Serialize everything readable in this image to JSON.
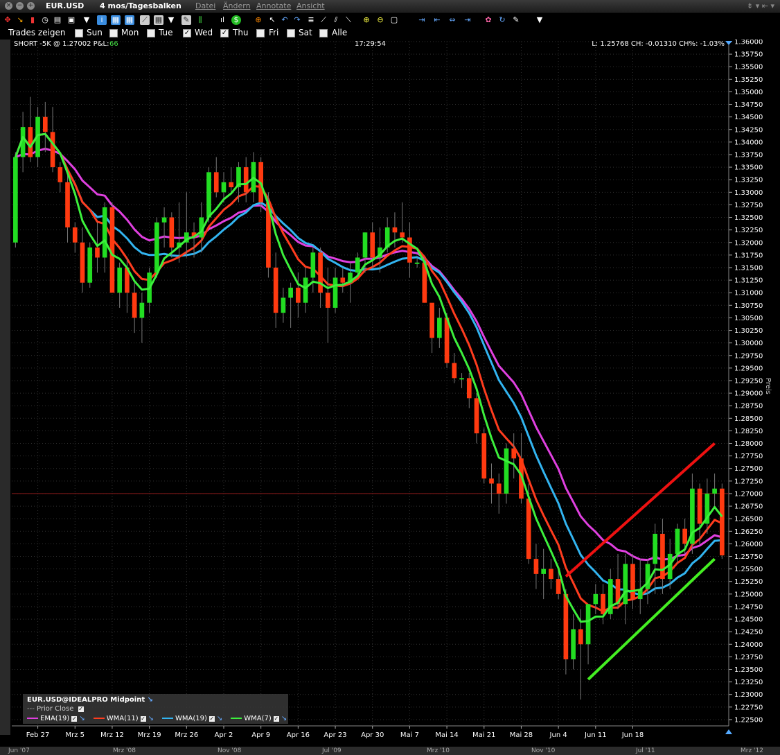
{
  "window": {
    "symbol": "EUR.USD",
    "timeframe": "4 mos/Tagesbalken",
    "menu": [
      "Datei",
      "Ändern",
      "Annotate",
      "Ansicht"
    ]
  },
  "trades_bar": {
    "label": "Trades zeigen",
    "days": [
      {
        "label": "Sun",
        "checked": false
      },
      {
        "label": "Mon",
        "checked": false
      },
      {
        "label": "Tue",
        "checked": false
      },
      {
        "label": "Wed",
        "checked": true
      },
      {
        "label": "Thu",
        "checked": true
      },
      {
        "label": "Fri",
        "checked": false
      },
      {
        "label": "Sat",
        "checked": false
      },
      {
        "label": "Alle",
        "checked": false
      }
    ]
  },
  "info": {
    "position": "SHORT -5K @ 1.27002 P&L:",
    "pnl": "66",
    "time": "17:29:54",
    "last": "L: 1.25768 CH: -0.01310 CH%: -1.03%"
  },
  "legend": {
    "title": "EUR.USD@IDEALPRO Midpoint",
    "prior_close": "Prior Close",
    "items": [
      {
        "label": "EMA(19)",
        "color": "#e040e0"
      },
      {
        "label": "WMA(11)",
        "color": "#ff3c1e"
      },
      {
        "label": "WMA(19)",
        "color": "#32b4f0"
      },
      {
        "label": "WMA(7)",
        "color": "#3cf03c"
      }
    ]
  },
  "navigator_labels": [
    "Jun '07",
    "Mrz '08",
    "Nov '08",
    "Jul '09",
    "Mrz '10",
    "Nov '10",
    "Jul '11",
    "Mrz '12"
  ],
  "colors": {
    "up": "#22dd22",
    "down": "#ff3a10",
    "background": "#000000",
    "grid": "#333333"
  },
  "chart_data": {
    "type": "candlestick",
    "ylabel": "Preis",
    "ylim": [
      1.22375,
      1.36
    ],
    "yticks": [
      "1.36000",
      "1.35750",
      "1.35500",
      "1.35250",
      "1.35000",
      "1.34750",
      "1.34500",
      "1.34250",
      "1.34000",
      "1.33750",
      "1.33500",
      "1.33250",
      "1.33000",
      "1.32750",
      "1.32500",
      "1.32250",
      "1.32000",
      "1.31750",
      "1.31500",
      "1.31250",
      "1.31000",
      "1.30750",
      "1.30500",
      "1.30250",
      "1.30000",
      "1.29750",
      "1.29500",
      "1.29250",
      "1.29000",
      "1.28750",
      "1.28500",
      "1.28250",
      "1.28000",
      "1.27750",
      "1.27500",
      "1.27250",
      "1.27000",
      "1.26750",
      "1.26500",
      "1.26250",
      "1.26000",
      "1.25750",
      "1.25500",
      "1.25250",
      "1.25000",
      "1.24750",
      "1.24500",
      "1.24250",
      "1.24000",
      "1.23750",
      "1.23500",
      "1.23250",
      "1.23000",
      "1.22750",
      "1.22500"
    ],
    "xticks": [
      {
        "label": "Feb 27",
        "bar": 3
      },
      {
        "label": "Mrz 5",
        "bar": 8
      },
      {
        "label": "Mrz 12",
        "bar": 13
      },
      {
        "label": "Mrz 19",
        "bar": 18
      },
      {
        "label": "Mrz 26",
        "bar": 23
      },
      {
        "label": "Apr 2",
        "bar": 28
      },
      {
        "label": "Apr 9",
        "bar": 33
      },
      {
        "label": "Apr 16",
        "bar": 38
      },
      {
        "label": "Apr 23",
        "bar": 43
      },
      {
        "label": "Apr 30",
        "bar": 48
      },
      {
        "label": "Mai 7",
        "bar": 53
      },
      {
        "label": "Mai 14",
        "bar": 58
      },
      {
        "label": "Mai 21",
        "bar": 63
      },
      {
        "label": "Mai 28",
        "bar": 68
      },
      {
        "label": "Jun 4",
        "bar": 73
      },
      {
        "label": "Jun 11",
        "bar": 78
      },
      {
        "label": "Jun 18",
        "bar": 83
      }
    ],
    "candles": [
      [
        1.32,
        1.338,
        1.319,
        1.337
      ],
      [
        1.337,
        1.346,
        1.334,
        1.343
      ],
      [
        1.343,
        1.349,
        1.336,
        1.337
      ],
      [
        1.337,
        1.347,
        1.335,
        1.345
      ],
      [
        1.345,
        1.348,
        1.338,
        1.342
      ],
      [
        1.342,
        1.347,
        1.334,
        1.335
      ],
      [
        1.335,
        1.336,
        1.33,
        1.332
      ],
      [
        1.332,
        1.334,
        1.32,
        1.323
      ],
      [
        1.323,
        1.324,
        1.318,
        1.32
      ],
      [
        1.32,
        1.323,
        1.31,
        1.312
      ],
      [
        1.312,
        1.32,
        1.311,
        1.319
      ],
      [
        1.319,
        1.324,
        1.314,
        1.317
      ],
      [
        1.317,
        1.328,
        1.314,
        1.327
      ],
      [
        1.327,
        1.328,
        1.312,
        1.31
      ],
      [
        1.31,
        1.316,
        1.307,
        1.315
      ],
      [
        1.315,
        1.317,
        1.306,
        1.31
      ],
      [
        1.31,
        1.312,
        1.302,
        1.305
      ],
      [
        1.305,
        1.31,
        1.3,
        1.308
      ],
      [
        1.308,
        1.315,
        1.306,
        1.314
      ],
      [
        1.314,
        1.325,
        1.313,
        1.324
      ],
      [
        1.324,
        1.327,
        1.319,
        1.325
      ],
      [
        1.325,
        1.326,
        1.317,
        1.319
      ],
      [
        1.319,
        1.328,
        1.316,
        1.32
      ],
      [
        1.32,
        1.33,
        1.317,
        1.322
      ],
      [
        1.322,
        1.324,
        1.317,
        1.321
      ],
      [
        1.321,
        1.328,
        1.318,
        1.325
      ],
      [
        1.325,
        1.335,
        1.324,
        1.334
      ],
      [
        1.334,
        1.337,
        1.329,
        1.33
      ],
      [
        1.33,
        1.334,
        1.328,
        1.332
      ],
      [
        1.332,
        1.335,
        1.33,
        1.331
      ],
      [
        1.331,
        1.336,
        1.328,
        1.335
      ],
      [
        1.335,
        1.337,
        1.328,
        1.33
      ],
      [
        1.33,
        1.338,
        1.328,
        1.336
      ],
      [
        1.336,
        1.337,
        1.326,
        1.328
      ],
      [
        1.328,
        1.33,
        1.313,
        1.315
      ],
      [
        1.315,
        1.318,
        1.303,
        1.306
      ],
      [
        1.306,
        1.311,
        1.304,
        1.309
      ],
      [
        1.309,
        1.312,
        1.303,
        1.311
      ],
      [
        1.311,
        1.314,
        1.305,
        1.308
      ],
      [
        1.308,
        1.315,
        1.306,
        1.313
      ],
      [
        1.313,
        1.319,
        1.31,
        1.318
      ],
      [
        1.318,
        1.319,
        1.307,
        1.31
      ],
      [
        1.31,
        1.315,
        1.3,
        1.307
      ],
      [
        1.307,
        1.315,
        1.306,
        1.313
      ],
      [
        1.313,
        1.315,
        1.31,
        1.312
      ],
      [
        1.312,
        1.316,
        1.308,
        1.314
      ],
      [
        1.314,
        1.318,
        1.313,
        1.317
      ],
      [
        1.317,
        1.322,
        1.314,
        1.322
      ],
      [
        1.322,
        1.324,
        1.315,
        1.317
      ],
      [
        1.317,
        1.323,
        1.314,
        1.319
      ],
      [
        1.319,
        1.325,
        1.318,
        1.323
      ],
      [
        1.323,
        1.326,
        1.319,
        1.322
      ],
      [
        1.322,
        1.328,
        1.32,
        1.321
      ],
      [
        1.321,
        1.324,
        1.313,
        1.316
      ],
      [
        1.316,
        1.317,
        1.315,
        1.316
      ],
      [
        1.316,
        1.317,
        1.308,
        1.308
      ],
      [
        1.308,
        1.307,
        1.298,
        1.301
      ],
      [
        1.301,
        1.307,
        1.299,
        1.305
      ],
      [
        1.305,
        1.306,
        1.295,
        1.296
      ],
      [
        1.296,
        1.298,
        1.292,
        1.293
      ],
      [
        1.293,
        1.294,
        1.291,
        1.293
      ],
      [
        1.293,
        1.294,
        1.287,
        1.289
      ],
      [
        1.289,
        1.29,
        1.28,
        1.282
      ],
      [
        1.282,
        1.283,
        1.272,
        1.273
      ],
      [
        1.273,
        1.276,
        1.268,
        1.272
      ],
      [
        1.272,
        1.274,
        1.266,
        1.27
      ],
      [
        1.27,
        1.28,
        1.268,
        1.279
      ],
      [
        1.279,
        1.282,
        1.273,
        1.277
      ],
      [
        1.277,
        1.282,
        1.268,
        1.269
      ],
      [
        1.269,
        1.272,
        1.256,
        1.257
      ],
      [
        1.257,
        1.26,
        1.251,
        1.254
      ],
      [
        1.254,
        1.259,
        1.249,
        1.255
      ],
      [
        1.255,
        1.257,
        1.251,
        1.253
      ],
      [
        1.253,
        1.255,
        1.249,
        1.25
      ],
      [
        1.25,
        1.251,
        1.234,
        1.237
      ],
      [
        1.237,
        1.246,
        1.235,
        1.243
      ],
      [
        1.243,
        1.247,
        1.229,
        1.24
      ],
      [
        1.24,
        1.247,
        1.236,
        1.248
      ],
      [
        1.248,
        1.252,
        1.246,
        1.25
      ],
      [
        1.25,
        1.252,
        1.244,
        1.246
      ],
      [
        1.246,
        1.255,
        1.245,
        1.253
      ],
      [
        1.253,
        1.258,
        1.247,
        1.248
      ],
      [
        1.248,
        1.258,
        1.244,
        1.256
      ],
      [
        1.256,
        1.258,
        1.247,
        1.249
      ],
      [
        1.249,
        1.257,
        1.246,
        1.251
      ],
      [
        1.251,
        1.257,
        1.248,
        1.256
      ],
      [
        1.256,
        1.264,
        1.25,
        1.262
      ],
      [
        1.262,
        1.265,
        1.25,
        1.253
      ],
      [
        1.253,
        1.261,
        1.251,
        1.258
      ],
      [
        1.258,
        1.264,
        1.256,
        1.263
      ],
      [
        1.263,
        1.265,
        1.258,
        1.26
      ],
      [
        1.26,
        1.274,
        1.258,
        1.271
      ],
      [
        1.271,
        1.272,
        1.26,
        1.264
      ],
      [
        1.264,
        1.273,
        1.262,
        1.27
      ],
      [
        1.27,
        1.274,
        1.267,
        1.271
      ],
      [
        1.271,
        1.272,
        1.257,
        1.2577
      ]
    ],
    "trendlines": [
      {
        "color": "#ee1111",
        "from": {
          "bar": 74,
          "y": 1.2535
        },
        "to": {
          "bar": 94,
          "y": 1.28
        }
      },
      {
        "color": "#44ee22",
        "from": {
          "bar": 77,
          "y": 1.233
        },
        "to": {
          "bar": 94,
          "y": 1.257
        }
      }
    ],
    "reference_line": {
      "y": 1.27002,
      "color": "#8a1a1a"
    },
    "grid": true
  }
}
